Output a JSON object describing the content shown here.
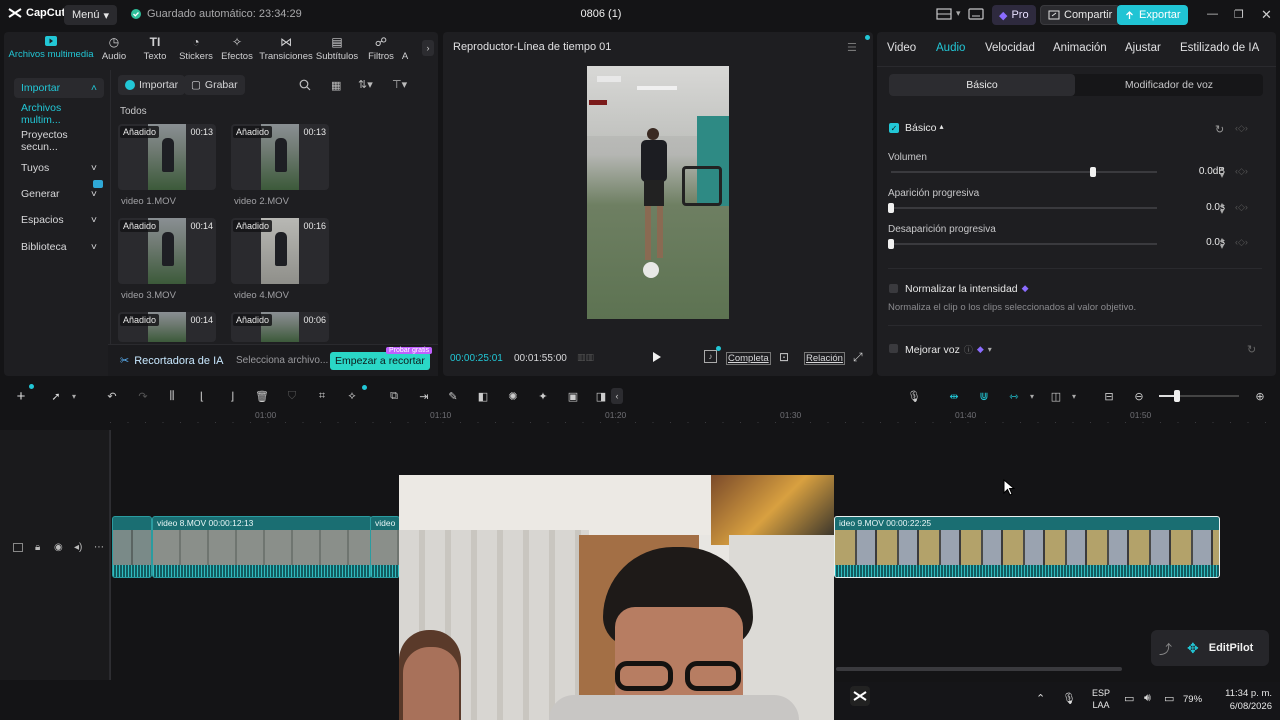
{
  "titlebar": {
    "app_name": "CapCut",
    "menu_label": "Menú",
    "autosave_text": "Guardado automático: 23:34:29",
    "project_title": "0806 (1)",
    "pro_label": "Pro",
    "share_label": "Compartir",
    "export_label": "Exportar"
  },
  "media": {
    "tabs": [
      {
        "label": "Archivos multimedia",
        "icon": "media-icon"
      },
      {
        "label": "Audio",
        "icon": "audio-icon"
      },
      {
        "label": "Texto",
        "icon": "text-icon"
      },
      {
        "label": "Stickers",
        "icon": "sticker-icon"
      },
      {
        "label": "Efectos",
        "icon": "effects-icon"
      },
      {
        "label": "Transiciones",
        "icon": "transitions-icon"
      },
      {
        "label": "Subtítulos",
        "icon": "subtitles-icon"
      },
      {
        "label": "Filtros",
        "icon": "filters-icon"
      },
      {
        "label": "A",
        "icon": "more-icon"
      }
    ],
    "sidebar": [
      {
        "label": "Importar"
      },
      {
        "label": "Archivos multim..."
      },
      {
        "label": "Proyectos secun..."
      },
      {
        "label": "Tuyos"
      },
      {
        "label": "Generar"
      },
      {
        "label": "Espacios"
      },
      {
        "label": "Biblioteca"
      }
    ],
    "import_label": "Importar",
    "record_label": "Grabar",
    "section_label": "Todos",
    "clips": [
      {
        "tag": "Añadido",
        "duration": "00:13",
        "name": "video 1.MOV"
      },
      {
        "tag": "Añadido",
        "duration": "00:13",
        "name": "video 2.MOV"
      },
      {
        "tag": "Añadido",
        "duration": "00:14",
        "name": "video 3.MOV"
      },
      {
        "tag": "Añadido",
        "duration": "00:16",
        "name": "video 4.MOV"
      },
      {
        "tag": "Añadido",
        "duration": "00:14",
        "name": ""
      },
      {
        "tag": "Añadido",
        "duration": "00:06",
        "name": ""
      }
    ],
    "ai_cutter_label": "Recortadora de IA",
    "ai_cutter_hint": "Selecciona archivo...",
    "ai_cutter_button": "Empezar a recortar",
    "ai_cutter_badge": "Probar gratis"
  },
  "player": {
    "title": "Reproductor-Línea de tiempo 01",
    "current_time": "00:00:25:01",
    "total_time": "00:01:55:00",
    "full_label": "Completa",
    "ratio_label": "Relación"
  },
  "props": {
    "tabs": [
      "Video",
      "Audio",
      "Velocidad",
      "Animación",
      "Ajustar",
      "Estilizado de IA"
    ],
    "subtabs": [
      "Básico",
      "Modificador de voz"
    ],
    "section": "Básico",
    "volume_label": "Volumen",
    "volume_value": "0.0dB",
    "volume_level": 0.76,
    "fade_in_label": "Aparición progresiva",
    "fade_in_value": "0.0s",
    "fade_out_label": "Desaparición progresiva",
    "fade_out_value": "0.0s",
    "normalize_label": "Normalizar la intensidad",
    "normalize_desc": "Normaliza el clip o los clips seleccionados al valor objetivo.",
    "enhance_label": "Mejorar voz"
  },
  "timeline": {
    "ticks": [
      "01:00",
      "01:10",
      "01:20",
      "01:30",
      "01:40",
      "01:50"
    ],
    "clip1_label": "video 8.MOV  00:00:12:13",
    "clip1b_label": "video 9",
    "clip2_label": "ideo 9.MOV  00:00:22:25"
  },
  "editpilot_label": "EditPilot",
  "taskbar": {
    "lang1": "ESP",
    "lang2": "LAA",
    "battery": "79%",
    "time": "11:34 p. m.",
    "date": "6/08/2026"
  },
  "colors": {
    "accent": "#22c7d6",
    "clip": "#1a6e72",
    "pro": "#8b6cff"
  }
}
